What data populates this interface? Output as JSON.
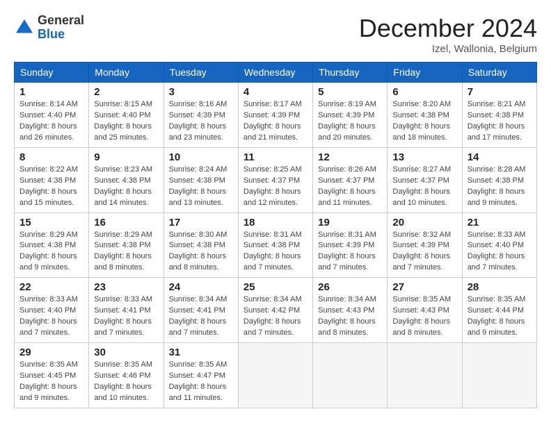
{
  "header": {
    "logo_general": "General",
    "logo_blue": "Blue",
    "month_title": "December 2024",
    "location": "Izel, Wallonia, Belgium"
  },
  "weekdays": [
    "Sunday",
    "Monday",
    "Tuesday",
    "Wednesday",
    "Thursday",
    "Friday",
    "Saturday"
  ],
  "weeks": [
    [
      {
        "day": "1",
        "info": "Sunrise: 8:14 AM\nSunset: 4:40 PM\nDaylight: 8 hours\nand 26 minutes."
      },
      {
        "day": "2",
        "info": "Sunrise: 8:15 AM\nSunset: 4:40 PM\nDaylight: 8 hours\nand 25 minutes."
      },
      {
        "day": "3",
        "info": "Sunrise: 8:16 AM\nSunset: 4:39 PM\nDaylight: 8 hours\nand 23 minutes."
      },
      {
        "day": "4",
        "info": "Sunrise: 8:17 AM\nSunset: 4:39 PM\nDaylight: 8 hours\nand 21 minutes."
      },
      {
        "day": "5",
        "info": "Sunrise: 8:19 AM\nSunset: 4:39 PM\nDaylight: 8 hours\nand 20 minutes."
      },
      {
        "day": "6",
        "info": "Sunrise: 8:20 AM\nSunset: 4:38 PM\nDaylight: 8 hours\nand 18 minutes."
      },
      {
        "day": "7",
        "info": "Sunrise: 8:21 AM\nSunset: 4:38 PM\nDaylight: 8 hours\nand 17 minutes."
      }
    ],
    [
      {
        "day": "8",
        "info": "Sunrise: 8:22 AM\nSunset: 4:38 PM\nDaylight: 8 hours\nand 15 minutes."
      },
      {
        "day": "9",
        "info": "Sunrise: 8:23 AM\nSunset: 4:38 PM\nDaylight: 8 hours\nand 14 minutes."
      },
      {
        "day": "10",
        "info": "Sunrise: 8:24 AM\nSunset: 4:38 PM\nDaylight: 8 hours\nand 13 minutes."
      },
      {
        "day": "11",
        "info": "Sunrise: 8:25 AM\nSunset: 4:37 PM\nDaylight: 8 hours\nand 12 minutes."
      },
      {
        "day": "12",
        "info": "Sunrise: 8:26 AM\nSunset: 4:37 PM\nDaylight: 8 hours\nand 11 minutes."
      },
      {
        "day": "13",
        "info": "Sunrise: 8:27 AM\nSunset: 4:37 PM\nDaylight: 8 hours\nand 10 minutes."
      },
      {
        "day": "14",
        "info": "Sunrise: 8:28 AM\nSunset: 4:38 PM\nDaylight: 8 hours\nand 9 minutes."
      }
    ],
    [
      {
        "day": "15",
        "info": "Sunrise: 8:29 AM\nSunset: 4:38 PM\nDaylight: 8 hours\nand 9 minutes."
      },
      {
        "day": "16",
        "info": "Sunrise: 8:29 AM\nSunset: 4:38 PM\nDaylight: 8 hours\nand 8 minutes."
      },
      {
        "day": "17",
        "info": "Sunrise: 8:30 AM\nSunset: 4:38 PM\nDaylight: 8 hours\nand 8 minutes."
      },
      {
        "day": "18",
        "info": "Sunrise: 8:31 AM\nSunset: 4:38 PM\nDaylight: 8 hours\nand 7 minutes."
      },
      {
        "day": "19",
        "info": "Sunrise: 8:31 AM\nSunset: 4:39 PM\nDaylight: 8 hours\nand 7 minutes."
      },
      {
        "day": "20",
        "info": "Sunrise: 8:32 AM\nSunset: 4:39 PM\nDaylight: 8 hours\nand 7 minutes."
      },
      {
        "day": "21",
        "info": "Sunrise: 8:33 AM\nSunset: 4:40 PM\nDaylight: 8 hours\nand 7 minutes."
      }
    ],
    [
      {
        "day": "22",
        "info": "Sunrise: 8:33 AM\nSunset: 4:40 PM\nDaylight: 8 hours\nand 7 minutes."
      },
      {
        "day": "23",
        "info": "Sunrise: 8:33 AM\nSunset: 4:41 PM\nDaylight: 8 hours\nand 7 minutes."
      },
      {
        "day": "24",
        "info": "Sunrise: 8:34 AM\nSunset: 4:41 PM\nDaylight: 8 hours\nand 7 minutes."
      },
      {
        "day": "25",
        "info": "Sunrise: 8:34 AM\nSunset: 4:42 PM\nDaylight: 8 hours\nand 7 minutes."
      },
      {
        "day": "26",
        "info": "Sunrise: 8:34 AM\nSunset: 4:43 PM\nDaylight: 8 hours\nand 8 minutes."
      },
      {
        "day": "27",
        "info": "Sunrise: 8:35 AM\nSunset: 4:43 PM\nDaylight: 8 hours\nand 8 minutes."
      },
      {
        "day": "28",
        "info": "Sunrise: 8:35 AM\nSunset: 4:44 PM\nDaylight: 8 hours\nand 9 minutes."
      }
    ],
    [
      {
        "day": "29",
        "info": "Sunrise: 8:35 AM\nSunset: 4:45 PM\nDaylight: 8 hours\nand 9 minutes."
      },
      {
        "day": "30",
        "info": "Sunrise: 8:35 AM\nSunset: 4:46 PM\nDaylight: 8 hours\nand 10 minutes."
      },
      {
        "day": "31",
        "info": "Sunrise: 8:35 AM\nSunset: 4:47 PM\nDaylight: 8 hours\nand 11 minutes."
      },
      null,
      null,
      null,
      null
    ]
  ]
}
